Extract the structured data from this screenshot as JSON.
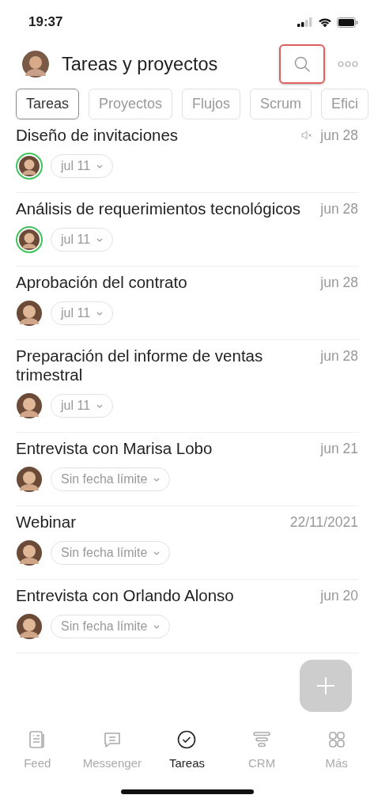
{
  "status_bar": {
    "time": "19:37"
  },
  "header": {
    "title": "Tareas y proyectos",
    "search_highlighted": true
  },
  "tabs": [
    {
      "label": "Tareas",
      "selected": true
    },
    {
      "label": "Proyectos",
      "selected": false
    },
    {
      "label": "Flujos",
      "selected": false
    },
    {
      "label": "Scrum",
      "selected": false
    },
    {
      "label": "Efici",
      "selected": false
    }
  ],
  "tasks": [
    {
      "title": "Diseño de invitaciones",
      "date": "jun 28",
      "muted": true,
      "deadline": "jul 11",
      "online": true
    },
    {
      "title": "Análisis de requerimientos tecnológicos",
      "date": "jun 28",
      "muted": false,
      "deadline": "jul 11",
      "online": true
    },
    {
      "title": "Aprobación del contrato",
      "date": "jun 28",
      "muted": false,
      "deadline": "jul 11",
      "online": false
    },
    {
      "title": "Preparación del informe de ventas trimestral",
      "date": "jun 28",
      "muted": false,
      "deadline": "jul 11",
      "online": false
    },
    {
      "title": "Entrevista con Marisa Lobo",
      "date": "jun 21",
      "muted": false,
      "deadline": "Sin fecha límite",
      "online": false
    },
    {
      "title": "Webinar",
      "date": "22/11/2021",
      "muted": false,
      "deadline": "Sin fecha límite",
      "online": false
    },
    {
      "title": "Entrevista con Orlando Alonso",
      "date": "jun 20",
      "muted": false,
      "deadline": "Sin fecha límite",
      "online": false
    }
  ],
  "nav": [
    {
      "label": "Feed",
      "kind": "feed",
      "selected": false
    },
    {
      "label": "Messenger",
      "kind": "messenger",
      "selected": false
    },
    {
      "label": "Tareas",
      "kind": "tasks",
      "selected": true
    },
    {
      "label": "CRM",
      "kind": "crm",
      "selected": false
    },
    {
      "label": "Más",
      "kind": "more",
      "selected": false
    }
  ]
}
